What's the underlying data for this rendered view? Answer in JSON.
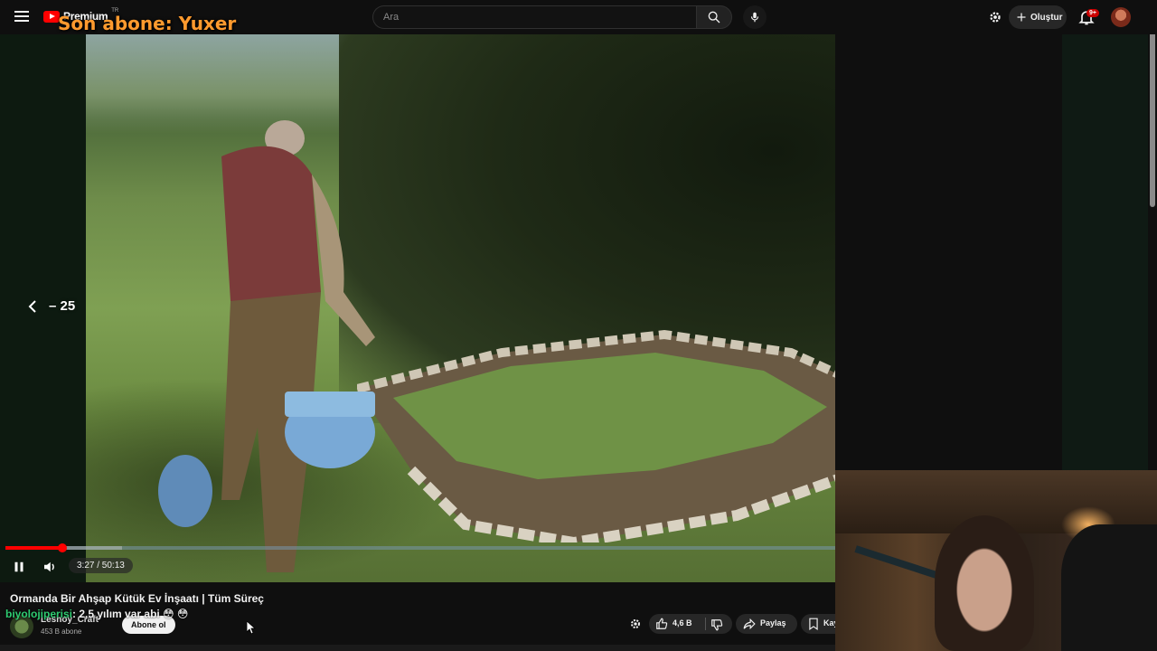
{
  "masthead": {
    "logo_text": "Premium",
    "logo_country": "TR",
    "overlay_text": "Son abone: Yuxer",
    "search_placeholder": "Ara",
    "create_label": "Oluştur",
    "notification_badge": "9+"
  },
  "player": {
    "seek_label": "– 25",
    "time_current": "3:27",
    "time_total": "50:13",
    "time_display": "3:27 / 50:13",
    "progress_played": 0.069,
    "progress_loaded": 0.14
  },
  "video": {
    "title": "Ormanda Bir Ahşap Kütük Ev İnşaatı | Tüm Süreç"
  },
  "chat_overlay": {
    "user": "biyolojiperisi",
    "message": ": 2,5 yılım var abi 😳 😳"
  },
  "channel": {
    "name": "Leshoy_Craft",
    "subscribers": "453 B abone",
    "subscribe_label": "Abone ol"
  },
  "actions": {
    "like_count": "4,6 B",
    "share_label": "Paylaş",
    "save_label": "Kaydet"
  },
  "colors": {
    "brand_red": "#ff0000",
    "overlay_orange": "#ff9a2e",
    "chat_user_green": "#2ecc71"
  }
}
